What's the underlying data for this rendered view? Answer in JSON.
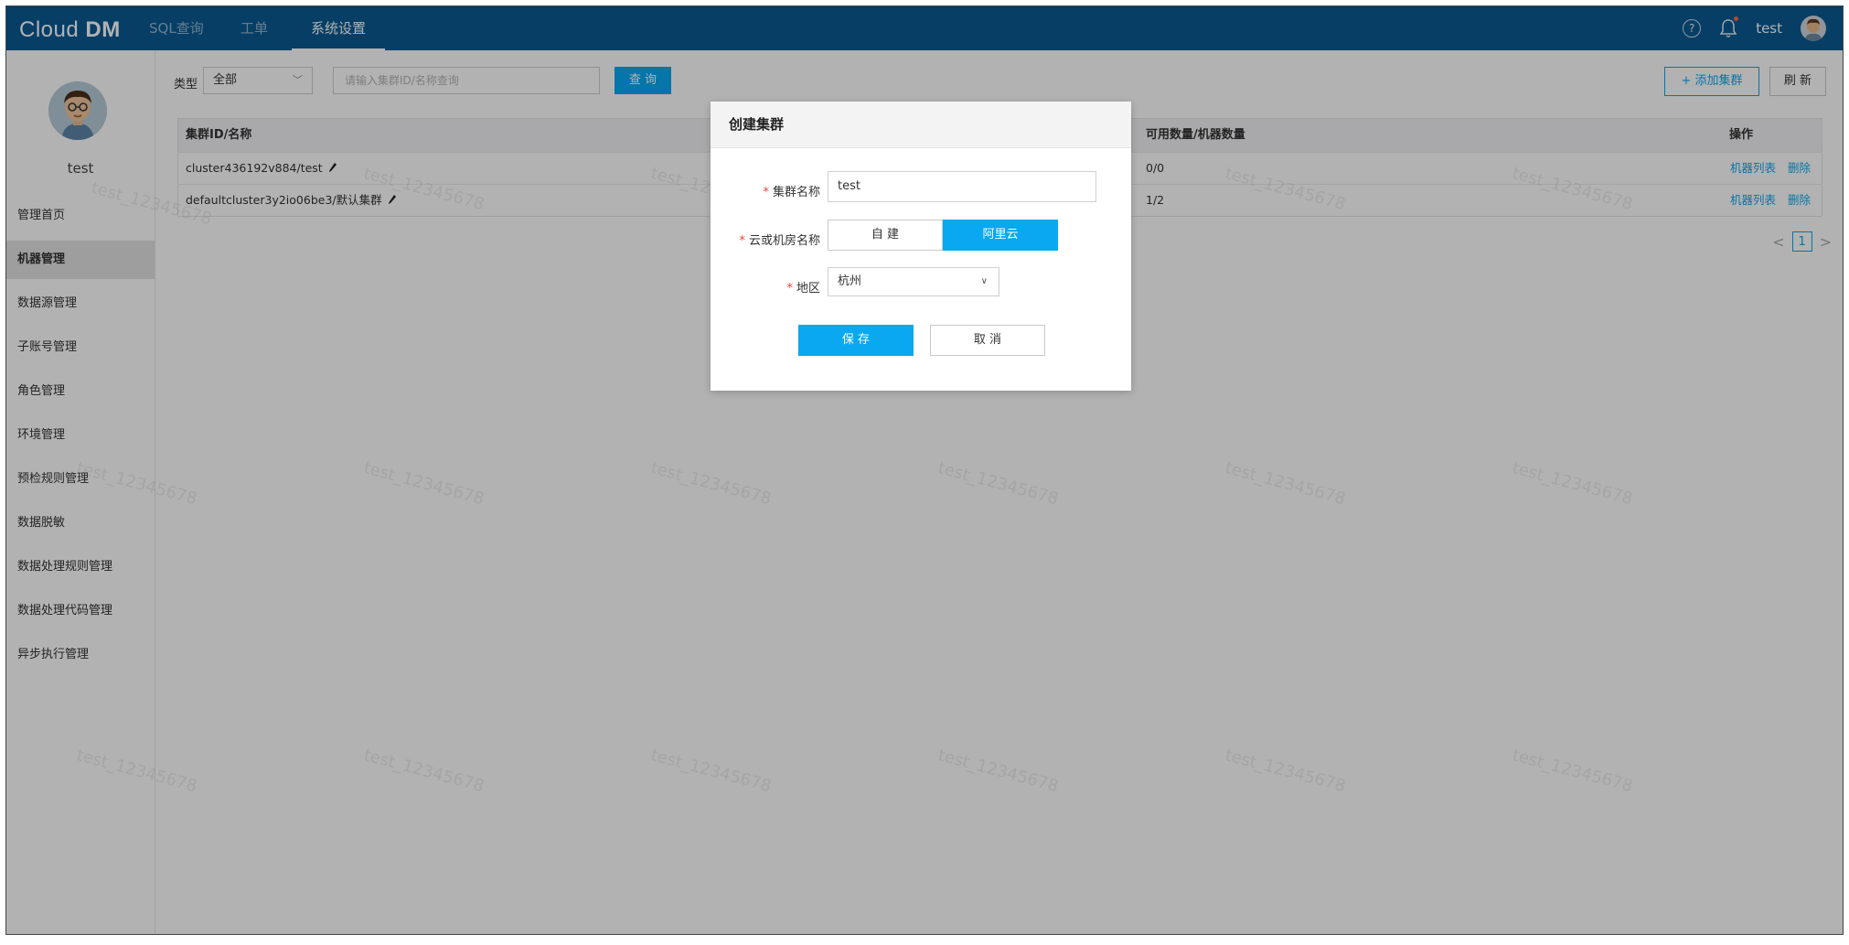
{
  "app": {
    "logo_light": "Cl",
    "logo_o": "o",
    "logo_rest": "ud ",
    "logo_bold": "DM"
  },
  "nav": {
    "items": [
      {
        "label": "SQL查询"
      },
      {
        "label": "工单"
      },
      {
        "label": "系统设置"
      }
    ],
    "active_index": 2
  },
  "header": {
    "help_icon_glyph": "?",
    "username": "test"
  },
  "sidebar": {
    "username": "test",
    "items": [
      {
        "label": "管理首页"
      },
      {
        "label": "机器管理"
      },
      {
        "label": "数据源管理"
      },
      {
        "label": "子账号管理"
      },
      {
        "label": "角色管理"
      },
      {
        "label": "环境管理"
      },
      {
        "label": "预检规则管理"
      },
      {
        "label": "数据脱敏"
      },
      {
        "label": "数据处理规则管理"
      },
      {
        "label": "数据处理代码管理"
      },
      {
        "label": "异步执行管理"
      }
    ],
    "active_index": 1
  },
  "filter": {
    "type_label": "类型",
    "type_value": "全部",
    "search_placeholder": "请输入集群ID/名称查询",
    "query_button": "查 询",
    "add_button": "+ 添加集群",
    "refresh_button": "刷 新"
  },
  "table": {
    "columns": [
      "集群ID/名称",
      "可用数量/机器数量",
      "操作"
    ],
    "rows": [
      {
        "name": "cluster436192v884/test",
        "count": "0/0",
        "action1": "机器列表",
        "action2": "删除"
      },
      {
        "name": "defaultcluster3y2io06be3/默认集群",
        "count": "1/2",
        "action1": "机器列表",
        "action2": "删除"
      }
    ]
  },
  "pagination": {
    "prev": "<",
    "current": "1",
    "next": ">"
  },
  "watermark": "test_12345678",
  "modal": {
    "title": "创建集群",
    "required_mark": "*",
    "name_label": "集群名称",
    "name_value": "test",
    "cloud_label": "云或机房名称",
    "cloud_options": [
      "自 建",
      "阿里云"
    ],
    "cloud_selected": 1,
    "region_label": "地区",
    "region_value": "杭州",
    "save_button": "保 存",
    "cancel_button": "取 消"
  },
  "colors": {
    "topbar": "#0a5a93",
    "accent": "#0aa8f0",
    "required": "#f04134"
  }
}
